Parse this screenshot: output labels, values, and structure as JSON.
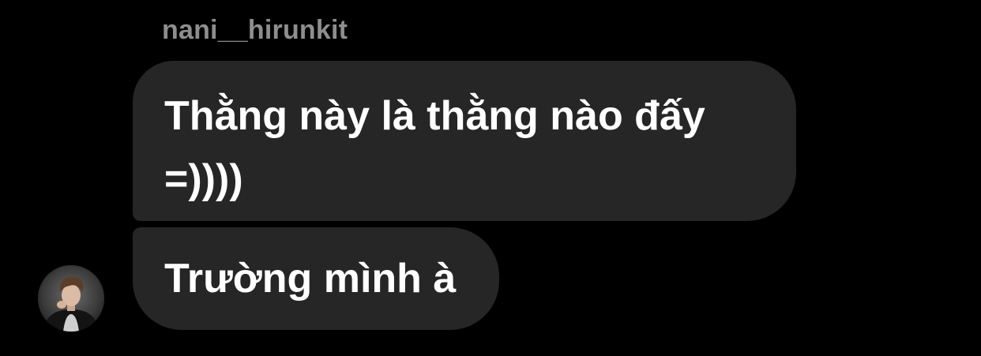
{
  "thread": {
    "sender_username": "nani__hirunkit",
    "messages": [
      {
        "text": "Thằng này là thằng nào đấy =))))"
      },
      {
        "text": "Trường mình à"
      }
    ],
    "avatar_icon": "profile-photo-avatar"
  }
}
